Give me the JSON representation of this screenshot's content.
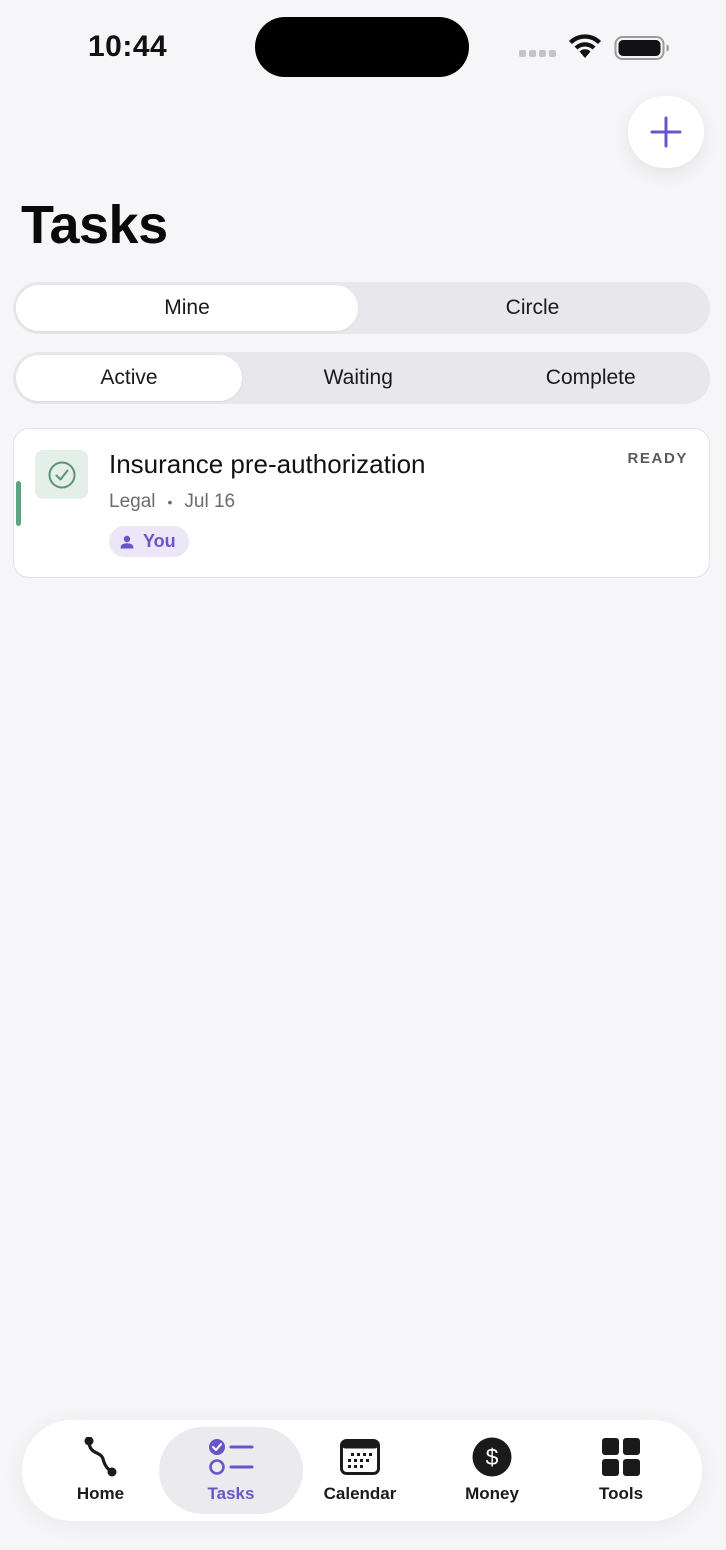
{
  "status_bar": {
    "time": "10:44"
  },
  "header": {
    "title": "Tasks",
    "add_icon": "plus-icon"
  },
  "scope_tabs": {
    "items": [
      "Mine",
      "Circle"
    ],
    "selected": "Mine"
  },
  "state_tabs": {
    "items": [
      "Active",
      "Waiting",
      "Complete"
    ],
    "selected": "Active"
  },
  "tasks": [
    {
      "title": "Insurance pre-authorization",
      "category": "Legal",
      "separator": "•",
      "date": "Jul 16",
      "status": "READY",
      "assignee": "You",
      "icon": "check-circle-icon",
      "accent_color": "#5aa57d"
    }
  ],
  "tab_bar": {
    "items": [
      {
        "label": "Home",
        "icon": "path-icon"
      },
      {
        "label": "Tasks",
        "icon": "task-list-icon"
      },
      {
        "label": "Calendar",
        "icon": "calendar-icon"
      },
      {
        "label": "Money",
        "icon": "dollar-icon"
      },
      {
        "label": "Tools",
        "icon": "grid-icon"
      }
    ],
    "selected": "Tasks"
  },
  "colors": {
    "accent": "#6a55c8",
    "background": "#f6f6f8",
    "ready_green": "#5aa57d"
  }
}
